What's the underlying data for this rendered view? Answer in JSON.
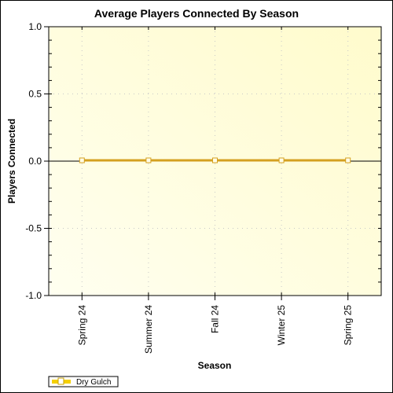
{
  "chart_data": {
    "type": "line",
    "title": "Average Players Connected By Season",
    "xlabel": "Season",
    "ylabel": "Players Connected",
    "categories": [
      "Spring 24",
      "Summer 24",
      "Fall 24",
      "Winter 25",
      "Spring 25"
    ],
    "series": [
      {
        "name": "Dry Gulch",
        "values": [
          0,
          0,
          0,
          0,
          0
        ],
        "color": "#d4a020",
        "legend_color": "#f5d000"
      }
    ],
    "ylim": [
      -1.0,
      1.0
    ],
    "yticks": [
      "1.0",
      "0.5",
      "0.0",
      "-0.5",
      "-1.0"
    ],
    "ytick_values": [
      1.0,
      0.5,
      0.0,
      -0.5,
      -1.0
    ],
    "grid": true,
    "legend_position": "bottom-left",
    "background_color": "#fffde0"
  }
}
